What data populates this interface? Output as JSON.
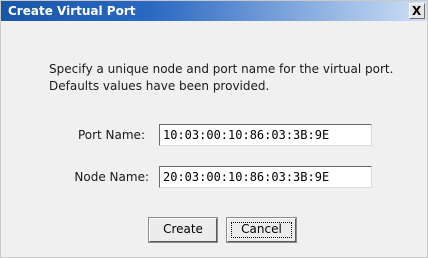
{
  "dialog": {
    "title": "Create Virtual Port",
    "close_glyph": "X"
  },
  "instructions": {
    "line1": "Specify a unique node and port name for the virtual port.",
    "line2": "Defaults values have been provided."
  },
  "fields": {
    "port_name_label": "Port Name:",
    "port_name_value": "10:03:00:10:86:03:3B:9E",
    "node_name_label": "Node Name:",
    "node_name_value": "20:03:00:10:86:03:3B:9E"
  },
  "buttons": {
    "create_label": "Create",
    "cancel_label": "Cancel"
  },
  "icons": {
    "close": "close-icon"
  },
  "colors": {
    "titlebar_start": "#1a56a8",
    "titlebar_end": "#cfe0f5",
    "dialog_bg": "#f0f0f0"
  }
}
